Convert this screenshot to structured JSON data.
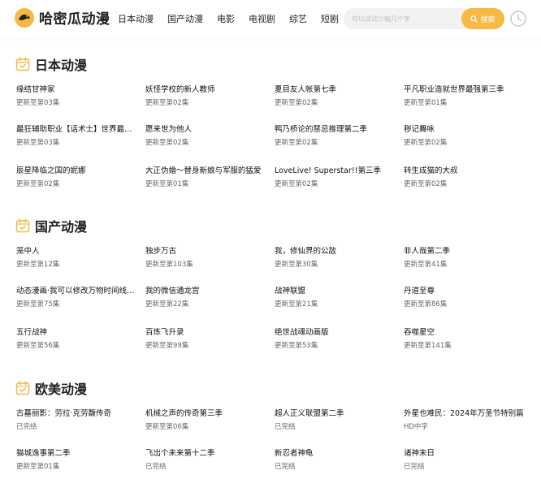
{
  "site": {
    "name": "哈密瓜动漫"
  },
  "nav": [
    "日本动漫",
    "国产动漫",
    "电影",
    "电视剧",
    "综艺",
    "短剧"
  ],
  "search": {
    "placeholder": "可以试试少输几个字",
    "button_label": "搜索"
  },
  "colors": {
    "accent": "#f5b944"
  },
  "sections": [
    {
      "title": "日本动漫",
      "items": [
        {
          "title": "缘结甘神家",
          "status": "更新至第03集"
        },
        {
          "title": "妖怪学校的新人教师",
          "status": "更新至第02集"
        },
        {
          "title": "夏目友人帐第七季",
          "status": "更新至第02集"
        },
        {
          "title": "平凡职业造就世界最强第三季",
          "status": "更新至第01集"
        },
        {
          "title": "最狂辅助职业【话术士】世界最强战团听我号令",
          "status": "更新至第03集"
        },
        {
          "title": "愿来世为他人",
          "status": "更新至第02集"
        },
        {
          "title": "鸭乃桥论的禁忌推理第二季",
          "status": "更新至第02集"
        },
        {
          "title": "秽记舞咏",
          "status": "更新至第02集"
        },
        {
          "title": "辰星降临之国的妮娜",
          "status": "更新至第02集"
        },
        {
          "title": "大正伪婚～替身新娘与军服的猛爱",
          "status": "更新至第01集"
        },
        {
          "title": "LoveLive! Superstar!!第三季",
          "status": "更新至第02集"
        },
        {
          "title": "转生成猫的大叔",
          "status": "更新至第02集"
        }
      ]
    },
    {
      "title": "国产动漫",
      "items": [
        {
          "title": "笼中人",
          "status": "更新至第12集"
        },
        {
          "title": "独步万古",
          "status": "更新至第103集"
        },
        {
          "title": "我，修仙界的公敌",
          "status": "更新至第30集"
        },
        {
          "title": "非人哉第二季",
          "status": "更新至第41集"
        },
        {
          "title": "动态漫画·我可以修改万物时间线第二季",
          "status": "更新至第75集"
        },
        {
          "title": "我的微信通龙宫",
          "status": "更新至第22集"
        },
        {
          "title": "战神联盟",
          "status": "更新至第21集"
        },
        {
          "title": "丹道至尊",
          "status": "更新至第86集"
        },
        {
          "title": "五行战神",
          "status": "更新至第56集"
        },
        {
          "title": "百炼飞升录",
          "status": "更新至第99集"
        },
        {
          "title": "绝世战魂动画版",
          "status": "更新至第53集"
        },
        {
          "title": "吞噬星空",
          "status": "更新至第141集"
        }
      ]
    },
    {
      "title": "欧美动漫",
      "items": [
        {
          "title": "古墓丽影：劳拉·克劳馥传奇",
          "status": "已完结"
        },
        {
          "title": "机械之声的传奇第三季",
          "status": "更新至第06集"
        },
        {
          "title": "超人正义联盟第二季",
          "status": "已完结"
        },
        {
          "title": "外星也难民：2024年万圣节特别篇",
          "status": "HD中字"
        },
        {
          "title": "猫城逸事第二季",
          "status": "更新至第01集"
        },
        {
          "title": "飞出个未来第十二季",
          "status": "已完结"
        },
        {
          "title": "新忍者神龟",
          "status": "已完结"
        },
        {
          "title": "诸神末日",
          "status": "已完结"
        }
      ]
    }
  ]
}
